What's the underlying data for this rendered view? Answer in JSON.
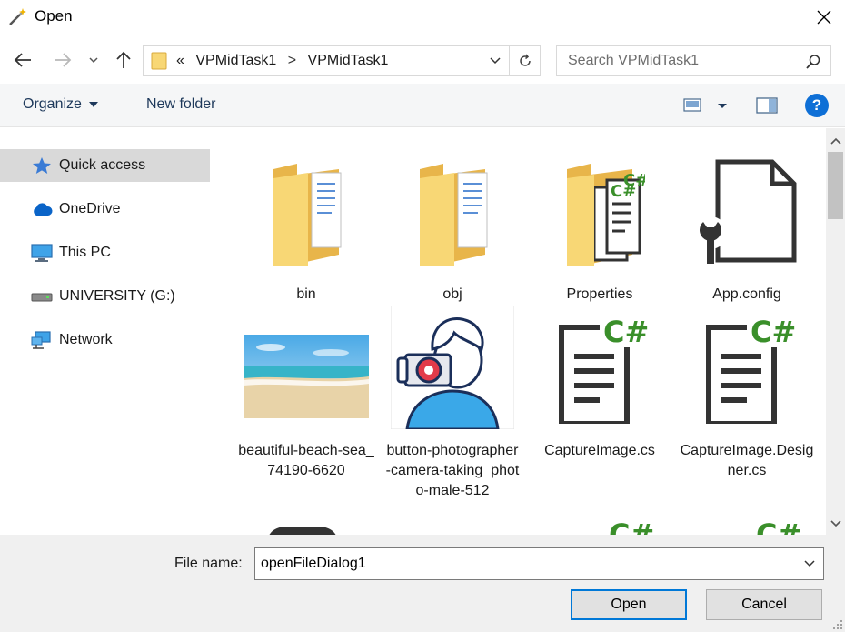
{
  "window": {
    "title": "Open",
    "icons": {
      "app": "magic-wand-icon",
      "close": "close-icon"
    }
  },
  "nav": {
    "icons": [
      "back-arrow-icon",
      "forward-arrow-icon",
      "recent-chevron-icon",
      "up-arrow-icon"
    ],
    "address": {
      "overflow": "«",
      "crumbs": [
        "VPMidTask1",
        "VPMidTask1"
      ],
      "separator": ">"
    },
    "search_placeholder": "Search VPMidTask1"
  },
  "toolbar": {
    "organize_label": "Organize",
    "new_folder_label": "New folder",
    "help_label": "?"
  },
  "sidebar": {
    "items": [
      {
        "label": "Quick access",
        "icon": "star-icon",
        "selected": true
      },
      {
        "label": "OneDrive",
        "icon": "cloud-icon",
        "selected": false
      },
      {
        "label": "This PC",
        "icon": "monitor-icon",
        "selected": false
      },
      {
        "label": "UNIVERSITY (G:)",
        "icon": "drive-icon",
        "selected": false
      },
      {
        "label": "Network",
        "icon": "network-icon",
        "selected": false
      }
    ]
  },
  "files": [
    {
      "name": "bin",
      "icon": "folder-icon"
    },
    {
      "name": "obj",
      "icon": "folder-icon"
    },
    {
      "name": "Properties",
      "icon": "csharp-folder-icon"
    },
    {
      "name": "App.config",
      "icon": "config-file-icon"
    },
    {
      "name": "beautiful-beach-sea_74190-6620",
      "icon": "beach-image-thumbnail"
    },
    {
      "name": "button-photographer-camera-taking_photo-male-512",
      "icon": "photographer-image-thumbnail"
    },
    {
      "name": "CaptureImage.cs",
      "icon": "csharp-file-icon"
    },
    {
      "name": "CaptureImage.Designer.cs",
      "icon": "csharp-file-icon"
    }
  ],
  "bottom": {
    "file_name_label": "File name:",
    "file_name_value": "openFileDialog1",
    "open_label": "Open",
    "cancel_label": "Cancel"
  },
  "colors": {
    "accent": "#0078d7",
    "toolbar_text": "#1e395b",
    "folder": "#f5c95a",
    "csharp_green": "#3a8f2a",
    "help_blue": "#0e6fd6"
  }
}
